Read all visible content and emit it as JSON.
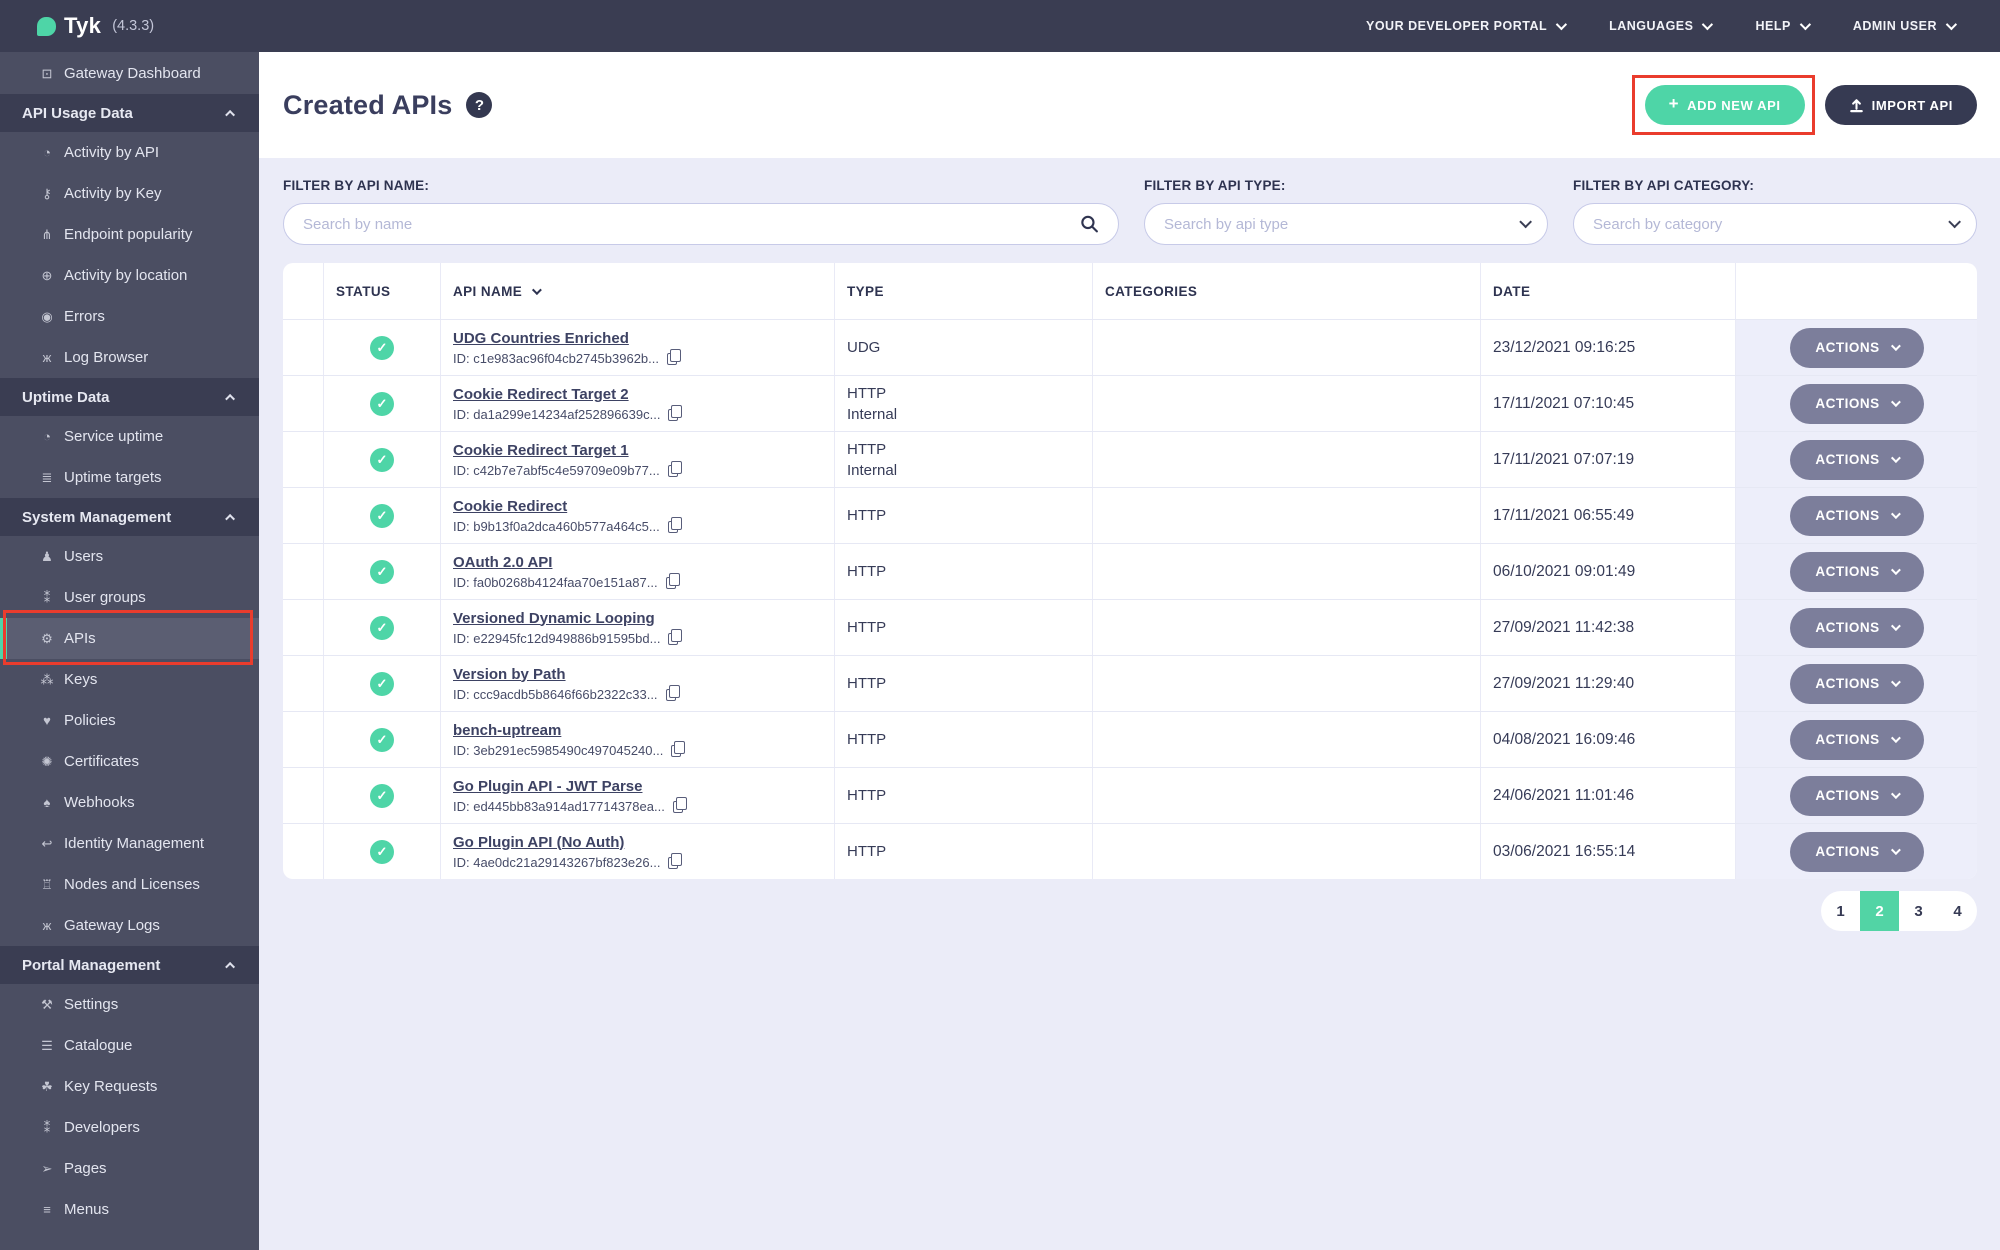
{
  "topbar": {
    "brand": "Tyk",
    "version": "(4.3.3)",
    "menus": [
      {
        "id": "your-developer-portal",
        "label": "YOUR DEVELOPER PORTAL"
      },
      {
        "id": "languages",
        "label": "LANGUAGES"
      },
      {
        "id": "help",
        "label": "HELP"
      },
      {
        "id": "admin-user",
        "label": "ADMIN USER"
      }
    ]
  },
  "sidebar": {
    "entries": [
      {
        "type": "item",
        "label": "Gateway Dashboard",
        "icon": "monitor-icon"
      },
      {
        "type": "header",
        "label": "API Usage Data"
      },
      {
        "type": "item",
        "label": "Activity by API",
        "icon": "gauge-icon"
      },
      {
        "type": "item",
        "label": "Activity by Key",
        "icon": "key-icon"
      },
      {
        "type": "item",
        "label": "Endpoint popularity",
        "icon": "fork-icon"
      },
      {
        "type": "item",
        "label": "Activity by location",
        "icon": "globe-icon"
      },
      {
        "type": "item",
        "label": "Errors",
        "icon": "bomb-icon"
      },
      {
        "type": "item",
        "label": "Log Browser",
        "icon": "bug-icon"
      },
      {
        "type": "header",
        "label": "Uptime Data"
      },
      {
        "type": "item",
        "label": "Service uptime",
        "icon": "gauge-icon"
      },
      {
        "type": "item",
        "label": "Uptime targets",
        "icon": "list-icon"
      },
      {
        "type": "header",
        "label": "System Management"
      },
      {
        "type": "item",
        "label": "Users",
        "icon": "user-icon"
      },
      {
        "type": "item",
        "label": "User groups",
        "icon": "users-icon"
      },
      {
        "type": "item",
        "label": "APIs",
        "icon": "gears-icon",
        "active": true,
        "annotated": true
      },
      {
        "type": "item",
        "label": "Keys",
        "icon": "sitemap-icon"
      },
      {
        "type": "item",
        "label": "Policies",
        "icon": "policy-icon"
      },
      {
        "type": "item",
        "label": "Certificates",
        "icon": "certificate-icon"
      },
      {
        "type": "item",
        "label": "Webhooks",
        "icon": "bell-icon"
      },
      {
        "type": "item",
        "label": "Identity Management",
        "icon": "identity-icon"
      },
      {
        "type": "item",
        "label": "Nodes and Licenses",
        "icon": "bank-icon"
      },
      {
        "type": "item",
        "label": "Gateway Logs",
        "icon": "bug-icon"
      },
      {
        "type": "header",
        "label": "Portal Management"
      },
      {
        "type": "item",
        "label": "Settings",
        "icon": "wrench-icon"
      },
      {
        "type": "item",
        "label": "Catalogue",
        "icon": "catalogue-icon"
      },
      {
        "type": "item",
        "label": "Key Requests",
        "icon": "paw-icon"
      },
      {
        "type": "item",
        "label": "Developers",
        "icon": "users-icon"
      },
      {
        "type": "item",
        "label": "Pages",
        "icon": "leaf-icon"
      },
      {
        "type": "item",
        "label": "Menus",
        "icon": "menu-icon"
      }
    ]
  },
  "page": {
    "title": "Created APIs",
    "add_button": "ADD NEW API",
    "import_button": "IMPORT API"
  },
  "filters": [
    {
      "id": "api-name",
      "kind": "search",
      "label": "FILTER BY API NAME:",
      "placeholder": "Search by name"
    },
    {
      "id": "api-type",
      "kind": "select",
      "label": "FILTER BY API TYPE:",
      "placeholder": "Search by api type"
    },
    {
      "id": "api-category",
      "kind": "select",
      "label": "FILTER BY API CATEGORY:",
      "placeholder": "Search by category"
    }
  ],
  "table": {
    "columns": [
      "STATUS",
      "API NAME",
      "TYPE",
      "CATEGORIES",
      "DATE"
    ],
    "actions_label": "ACTIONS",
    "rows": [
      {
        "status": "ok",
        "name": "UDG Countries Enriched",
        "id": "ID: c1e983ac96f04cb2745b3962b...",
        "type": [
          "UDG"
        ],
        "categories": "",
        "date": "23/12/2021 09:16:25"
      },
      {
        "status": "ok",
        "name": "Cookie Redirect Target 2",
        "id": "ID: da1a299e14234af252896639c...",
        "type": [
          "HTTP",
          "Internal"
        ],
        "categories": "",
        "date": "17/11/2021 07:10:45"
      },
      {
        "status": "ok",
        "name": "Cookie Redirect Target 1",
        "id": "ID: c42b7e7abf5c4e59709e09b77...",
        "type": [
          "HTTP",
          "Internal"
        ],
        "categories": "",
        "date": "17/11/2021 07:07:19"
      },
      {
        "status": "ok",
        "name": "Cookie Redirect",
        "id": "ID: b9b13f0a2dca460b577a464c5...",
        "type": [
          "HTTP"
        ],
        "categories": "",
        "date": "17/11/2021 06:55:49"
      },
      {
        "status": "ok",
        "name": "OAuth 2.0 API",
        "id": "ID: fa0b0268b4124faa70e151a87...",
        "type": [
          "HTTP"
        ],
        "categories": "",
        "date": "06/10/2021 09:01:49"
      },
      {
        "status": "ok",
        "name": "Versioned Dynamic Looping",
        "id": "ID: e22945fc12d949886b91595bd...",
        "type": [
          "HTTP"
        ],
        "categories": "",
        "date": "27/09/2021 11:42:38"
      },
      {
        "status": "ok",
        "name": "Version by Path",
        "id": "ID: ccc9acdb5b8646f66b2322c33...",
        "type": [
          "HTTP"
        ],
        "categories": "",
        "date": "27/09/2021 11:29:40"
      },
      {
        "status": "ok",
        "name": "bench-uptream",
        "id": "ID: 3eb291ec5985490c497045240...",
        "type": [
          "HTTP"
        ],
        "categories": "",
        "date": "04/08/2021 16:09:46"
      },
      {
        "status": "ok",
        "name": "Go Plugin API - JWT Parse",
        "id": "ID: ed445bb83a914ad17714378ea...",
        "type": [
          "HTTP"
        ],
        "categories": "",
        "date": "24/06/2021 11:01:46"
      },
      {
        "status": "ok",
        "name": "Go Plugin API (No Auth)",
        "id": "ID: 4ae0dc21a29143267bf823e26...",
        "type": [
          "HTTP"
        ],
        "categories": "",
        "date": "03/06/2021 16:55:14"
      }
    ]
  },
  "pagination": {
    "pages": [
      "1",
      "2",
      "3",
      "4"
    ],
    "active": "2"
  },
  "icons": {
    "help": "?",
    "plus": "+",
    "check": "✓",
    "monitor-icon": "⊡",
    "gauge-icon": "◔",
    "key-icon": "⚷",
    "fork-icon": "⋔",
    "globe-icon": "⊕",
    "bomb-icon": "◉",
    "bug-icon": "ж",
    "list-icon": "≣",
    "user-icon": "♟",
    "users-icon": "⁑",
    "gears-icon": "⚙",
    "sitemap-icon": "⁂",
    "policy-icon": "♥",
    "certificate-icon": "✺",
    "bell-icon": "♠",
    "identity-icon": "↩",
    "bank-icon": "♖",
    "wrench-icon": "⚒",
    "catalogue-icon": "☰",
    "paw-icon": "☘",
    "leaf-icon": "➢",
    "menu-icon": "≡"
  },
  "colors": {
    "accent_teal": "#4ed5a7",
    "navy": "#3a3d52",
    "sidebar_bg": "#4b4e62",
    "lavender_bg": "#ebecf8",
    "annotation_red": "#ea3c2d",
    "actions_pill": "#7c7e9b"
  }
}
